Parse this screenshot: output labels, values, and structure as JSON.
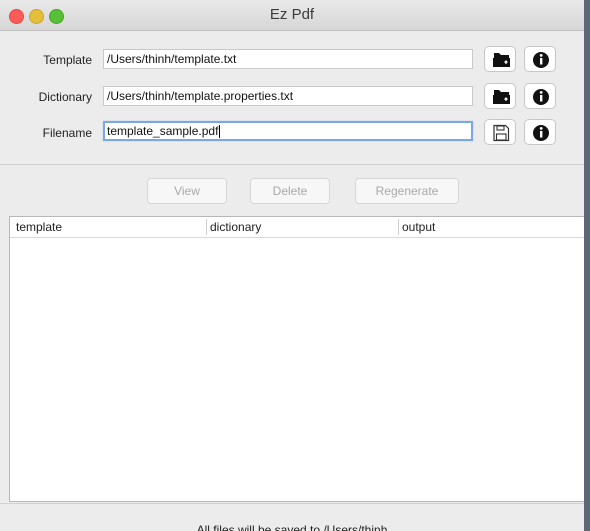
{
  "window": {
    "title": "Ez Pdf"
  },
  "form": {
    "template": {
      "label": "Template",
      "value": "/Users/thinh/template.txt"
    },
    "dictionary": {
      "label": "Dictionary",
      "value": "/Users/thinh/template.properties.txt"
    },
    "filename": {
      "label": "Filename",
      "value": "template_sample.pdf"
    }
  },
  "icons": {
    "open_folder": "folder-open-icon",
    "info": "info-icon",
    "save": "save-disk-icon"
  },
  "actions": {
    "view": "View",
    "delete": "Delete",
    "regenerate": "Regenerate"
  },
  "table": {
    "columns": [
      "template",
      "dictionary",
      "output"
    ],
    "rows": []
  },
  "status": {
    "text": "All files will be saved to /Users/thinh"
  },
  "colors": {
    "accent_focus": "#7aa7e8",
    "close": "#fc5b57",
    "minimize": "#e5bf3c",
    "zoom": "#57c038"
  }
}
